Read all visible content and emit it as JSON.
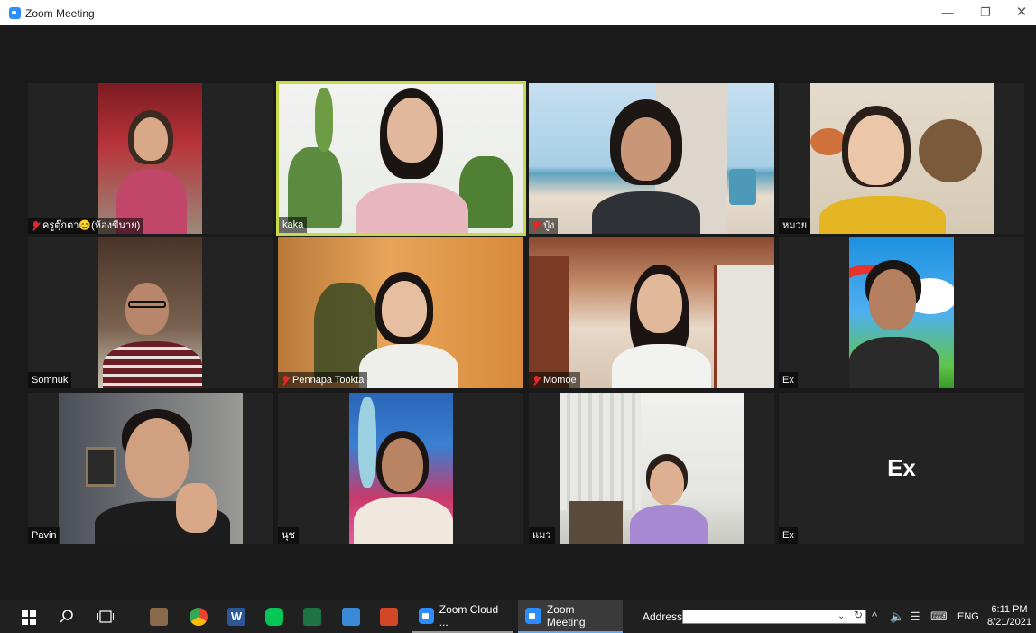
{
  "window": {
    "title": "Zoom Meeting",
    "controls": {
      "minimize": "—",
      "maximize": "❐",
      "close": "✕"
    }
  },
  "participants": [
    {
      "name": "ครูตุ๊กตา😊(ห้องขีนาย)",
      "muted": true
    },
    {
      "name": "kaka",
      "muted": false,
      "active_speaker": true
    },
    {
      "name": "ปู๋ง",
      "muted": true
    },
    {
      "name": "หมวย",
      "muted": false
    },
    {
      "name": "Somnuk",
      "muted": false
    },
    {
      "name": "Pennapa Tookta",
      "muted": true
    },
    {
      "name": "Momoe",
      "muted": true
    },
    {
      "name": "Ex",
      "muted": false
    },
    {
      "name": "Pavin",
      "muted": false
    },
    {
      "name": "นุช",
      "muted": false
    },
    {
      "name": "แมว",
      "muted": false
    },
    {
      "name": "Ex",
      "muted": false,
      "video_off": true,
      "display_name": "Ex"
    }
  ],
  "taskbar": {
    "apps": [
      {
        "label": "Zoom Cloud ..."
      },
      {
        "label": "Zoom Meeting"
      }
    ],
    "address_label": "Address",
    "address_value": "",
    "language": "ENG",
    "time": "6:11 PM",
    "date": "8/21/2021"
  },
  "colors": {
    "active_speaker_border": "#c8d94a",
    "muted_icon": "#e02828",
    "zoom_blue": "#2d8cff"
  }
}
